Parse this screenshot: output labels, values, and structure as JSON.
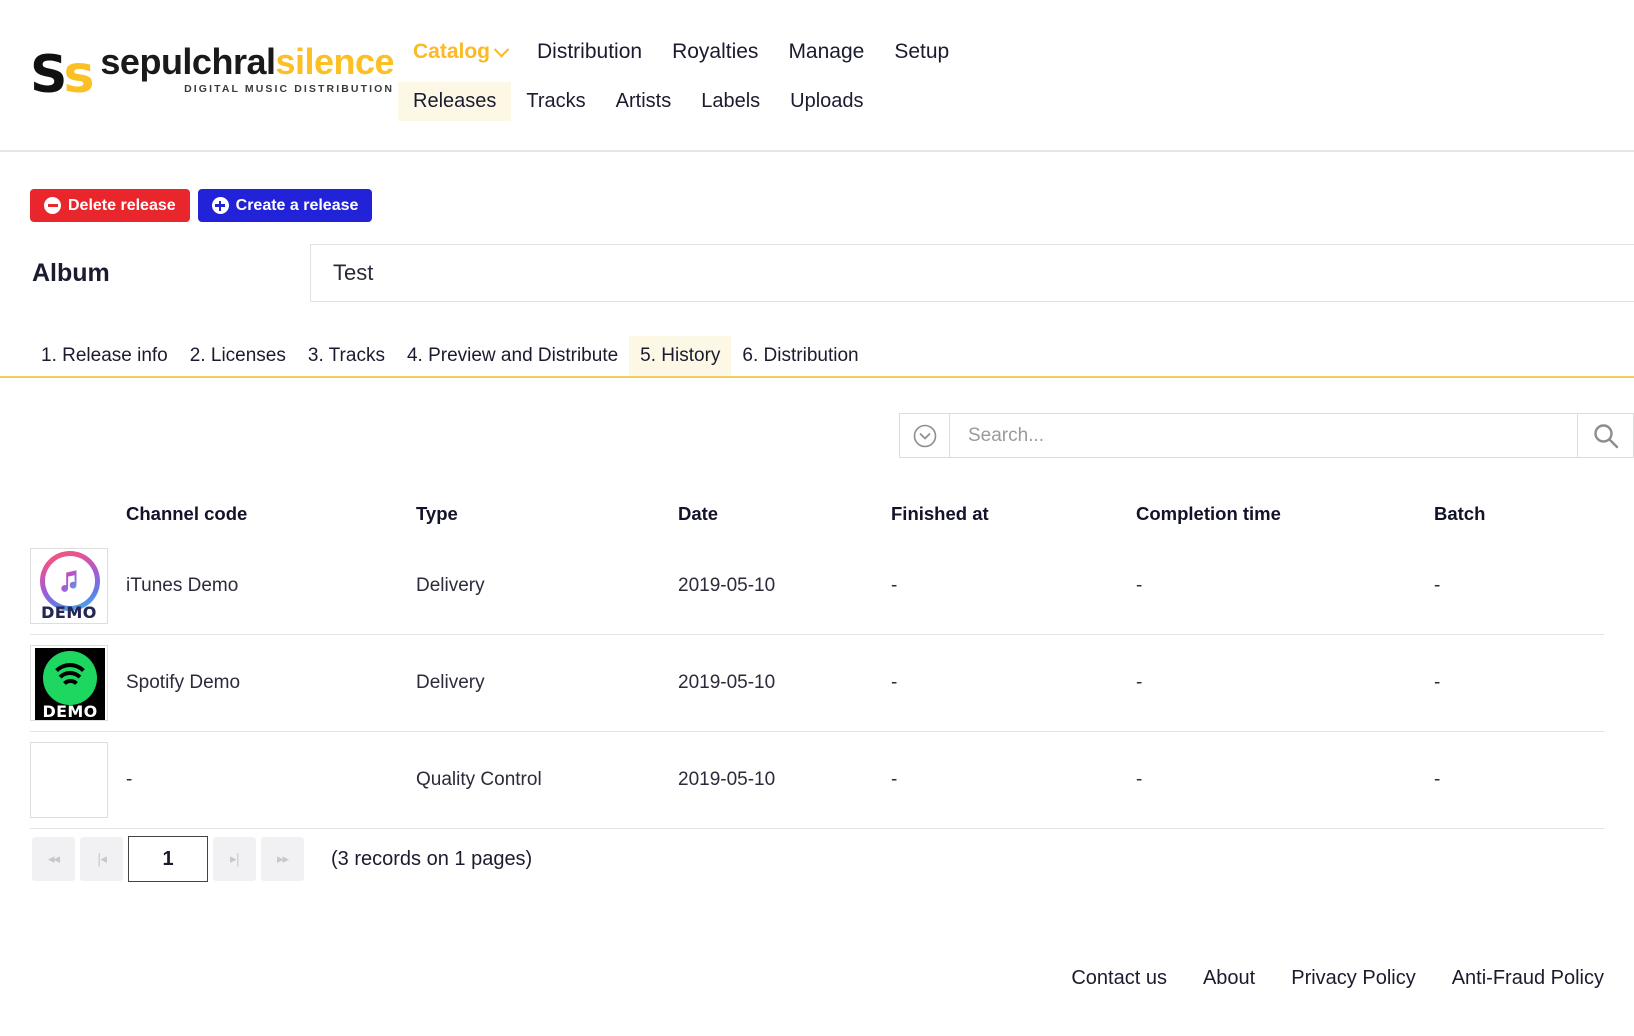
{
  "brand": {
    "mark_first": "S",
    "mark_second": "s",
    "name_first": "sepulchral",
    "name_second": "silence",
    "tagline": "DIGITAL MUSIC DISTRIBUTION"
  },
  "nav": {
    "top": [
      {
        "label": "Catalog",
        "active": true,
        "has_chevron": true
      },
      {
        "label": "Distribution",
        "active": false
      },
      {
        "label": "Royalties",
        "active": false
      },
      {
        "label": "Manage",
        "active": false
      },
      {
        "label": "Setup",
        "active": false
      }
    ],
    "sub": [
      {
        "label": "Releases",
        "active": true
      },
      {
        "label": "Tracks",
        "active": false
      },
      {
        "label": "Artists",
        "active": false
      },
      {
        "label": "Labels",
        "active": false
      },
      {
        "label": "Uploads",
        "active": false
      }
    ]
  },
  "toolbar": {
    "delete_label": "Delete release",
    "create_label": "Create a release",
    "delete_color": "#e8262b",
    "create_color": "#2222d8"
  },
  "album": {
    "label": "Album",
    "value": "Test"
  },
  "tabs": [
    {
      "label": "1. Release info",
      "active": false
    },
    {
      "label": "2. Licenses",
      "active": false
    },
    {
      "label": "3. Tracks",
      "active": false
    },
    {
      "label": "4. Preview and Distribute",
      "active": false
    },
    {
      "label": "5. History",
      "active": true
    },
    {
      "label": "6. Distribution",
      "active": false
    }
  ],
  "search": {
    "placeholder": "Search...",
    "value": ""
  },
  "table": {
    "headers": [
      "Channel code",
      "Type",
      "Date",
      "Finished at",
      "Completion time",
      "Batch"
    ],
    "rows": [
      {
        "icon": "itunes-demo-icon",
        "icon_badge": "DEMO",
        "channel_code": "iTunes Demo",
        "type": "Delivery",
        "date": "2019-05-10",
        "finished_at": "-",
        "completion_time": "-",
        "batch": "-"
      },
      {
        "icon": "spotify-demo-icon",
        "icon_badge": "DEMO",
        "channel_code": "Spotify Demo",
        "type": "Delivery",
        "date": "2019-05-10",
        "finished_at": "-",
        "completion_time": "-",
        "batch": "-"
      },
      {
        "icon": "blank-icon",
        "icon_badge": "",
        "channel_code": "-",
        "type": "Quality Control",
        "date": "2019-05-10",
        "finished_at": "-",
        "completion_time": "-",
        "batch": "-"
      }
    ]
  },
  "pager": {
    "first_label": "◂◂",
    "prev_label": "|◂",
    "next_label": "▸|",
    "last_label": "▸▸",
    "page_value": "1",
    "records_text": "(3 records on 1 pages)"
  },
  "footer": {
    "links": [
      "Contact us",
      "About",
      "Privacy Policy",
      "Anti-Fraud Policy"
    ]
  }
}
